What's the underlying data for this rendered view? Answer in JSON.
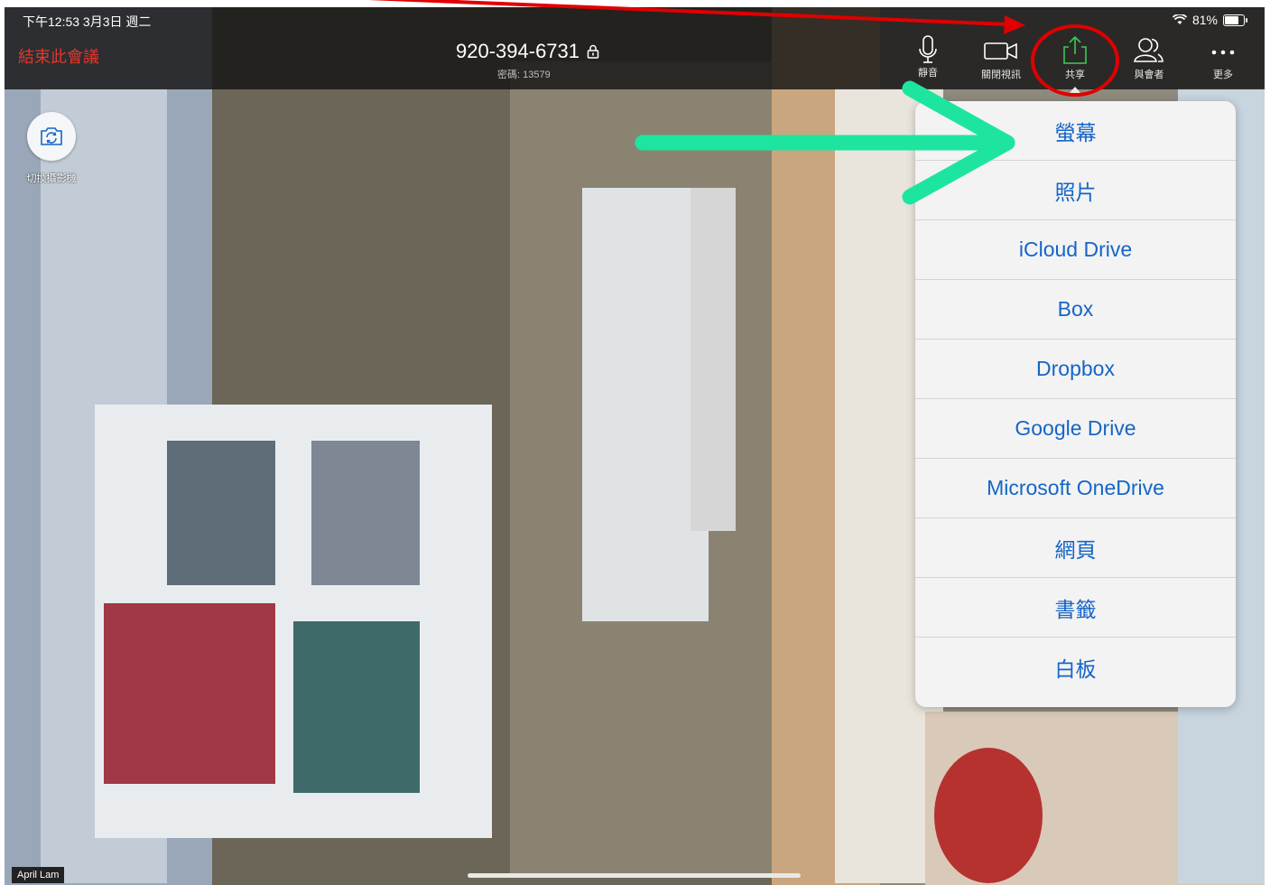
{
  "status_bar": {
    "time": "下午12:53  3月3日 週二",
    "battery": "81%"
  },
  "meeting": {
    "end_label": "結束此會議",
    "id": "920-394-6731",
    "passcode": "密碼: 13579"
  },
  "toolbar": {
    "mute": "靜音",
    "stop_video": "關閉視訊",
    "share": "共享",
    "participants": "與會者",
    "more": "更多"
  },
  "share_menu": {
    "items": [
      "螢幕",
      "照片",
      "iCloud Drive",
      "Box",
      "Dropbox",
      "Google Drive",
      "Microsoft OneDrive",
      "網頁",
      "書籤",
      "白板"
    ]
  },
  "switch_camera": {
    "label": "切換攝影機"
  },
  "video": {
    "participant_name": "April Lam"
  },
  "colors": {
    "end_meeting": "#e5352b",
    "share_accent": "#3cc85a",
    "menu_text": "#1565c7",
    "annotation_red": "#e00000",
    "annotation_green": "#1de5a0"
  },
  "icons": [
    "mic-icon",
    "video-camera-icon",
    "share-up-icon",
    "participants-icon",
    "more-dots-icon",
    "switch-camera-icon",
    "lock-icon",
    "wifi-icon",
    "battery-icon"
  ]
}
